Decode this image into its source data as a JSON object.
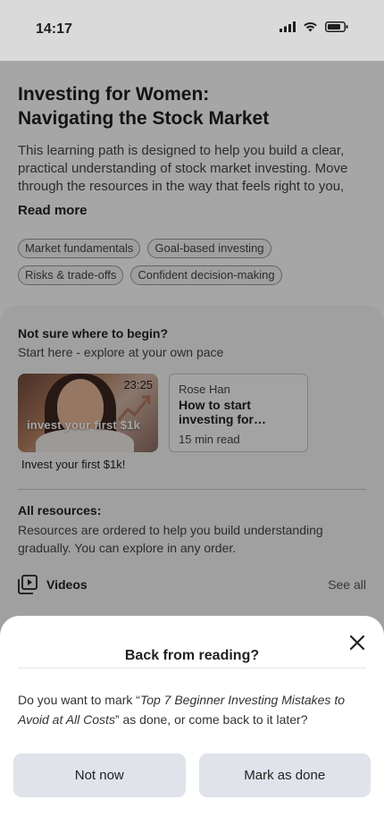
{
  "status_bar": {
    "time": "14:17"
  },
  "learning_path": {
    "title_line1": "Investing for Women:",
    "title_line2": "Navigating the Stock Market",
    "description": "This learning path is designed to help you build a clear, practical understanding of stock market investing. Move through the resources in the way that feels right to you, re...",
    "read_more": "Read more",
    "tags": [
      "Market fundamentals",
      "Goal-based investing",
      "Risks & trade-offs",
      "Confident decision-making"
    ]
  },
  "start_section": {
    "heading": "Not sure where to begin?",
    "subheading": "Start here - explore at your own pace",
    "video": {
      "duration": "23:25",
      "thumbnail_caption": "invest your first $1k",
      "title": "Invest your first $1k!"
    },
    "article": {
      "author": "Rose Han",
      "title": "How to start investing for beginners",
      "meta": "15 min read"
    }
  },
  "all_resources": {
    "title": "All resources:",
    "description": "Resources are ordered to help you build understanding gradually. You can explore in any order.",
    "videos_label": "Videos",
    "see_all": "See all"
  },
  "dialog": {
    "title": "Back from reading?",
    "body_prefix": "Do you want to mark “",
    "body_quoted": "Top 7 Beginner Investing Mistakes to Avoid at All Costs",
    "body_suffix": "” as done, or come back to it later?",
    "not_now": "Not now",
    "mark_done": "Mark as done"
  },
  "colors": {
    "overlay": "#000000",
    "button_bg": "#e0e3ea",
    "status_bar_bg": "#dadada"
  }
}
